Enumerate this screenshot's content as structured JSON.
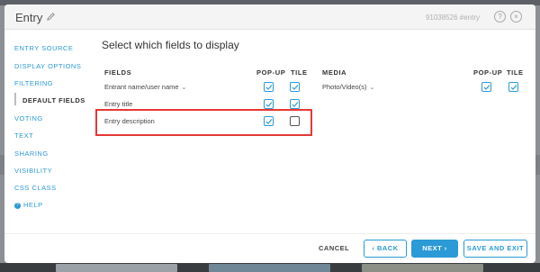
{
  "modal": {
    "title": "Entry",
    "entry_id": "91038526 #entry",
    "help_glyph": "?",
    "close_glyph": "×"
  },
  "sidebar": {
    "items": [
      {
        "label": "ENTRY SOURCE"
      },
      {
        "label": "DISPLAY OPTIONS"
      },
      {
        "label": "FILTERING"
      },
      {
        "label": "DEFAULT FIELDS",
        "active": true
      },
      {
        "label": "VOTING"
      },
      {
        "label": "TEXT"
      },
      {
        "label": "SHARING"
      },
      {
        "label": "VISIBILITY"
      },
      {
        "label": "CSS CLASS"
      }
    ],
    "help_label": "HELP"
  },
  "main": {
    "title": "Select which fields to display",
    "headers": {
      "fields": "FIELDS",
      "popup": "POP-UP",
      "tile": "TILE",
      "media": "MEDIA",
      "media_popup": "POP-UP",
      "media_tile": "TILE"
    },
    "field_rows": [
      {
        "label": "Entrant name/user name",
        "dropdown": true,
        "popup": true,
        "tile": true
      },
      {
        "label": "Entry title",
        "dropdown": false,
        "popup": true,
        "tile": true
      },
      {
        "label": "Entry description",
        "dropdown": false,
        "popup": true,
        "tile": false
      }
    ],
    "media_rows": [
      {
        "label": "Photo/Video(s)",
        "dropdown": true,
        "popup": true,
        "tile": true
      }
    ],
    "chevron_glyph": "⌄"
  },
  "footer": {
    "cancel_label": "CANCEL",
    "back_label": "‹ BACK",
    "next_label": "NEXT ›",
    "save_label": "SAVE AND EXIT"
  },
  "colors": {
    "accent": "#2b9ad6",
    "highlight": "#e53935"
  }
}
